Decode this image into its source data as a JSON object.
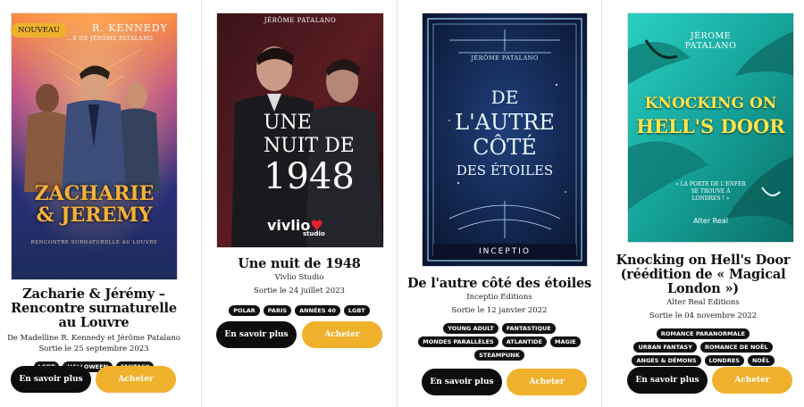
{
  "books": [
    {
      "badge": "NOUVEAU",
      "cover_author": "R. KENNEDY",
      "cover_sub_author": "…S DE JÉRÔME PATALANO",
      "cover_title_line1": "ZACHARIE",
      "cover_title_line2": "& JEREMY",
      "cover_tagline": "RENCONTRE SURNATURELLE AU LOUVRE",
      "title": "Zacharie & Jérémy – Rencontre surnaturelle au Louvre",
      "authors": "De Madelline R. Kennedy et Jérôme Patalano",
      "release": "Sortie le 25 septembre 2023",
      "tags": [
        "LGBT",
        "HALLOWEEN",
        "FANTASY"
      ],
      "more_label": "En savoir plus",
      "buy_label": "Acheter"
    },
    {
      "cover_author": "JÉRÔME PATALANO",
      "cover_title_line1": "UNE",
      "cover_title_line2": "NUIT DE",
      "cover_title_line3": "1948",
      "cover_publisher": "vivlio",
      "cover_publisher_sub": "studio",
      "title": "Une nuit de 1948",
      "publisher": "Vivlio Studio",
      "release": "Sortie le 24 juillet 2023",
      "tags": [
        "POLAR",
        "PARIS",
        "ANNÉES 40",
        "LGBT"
      ],
      "more_label": "En savoir plus",
      "buy_label": "Acheter"
    },
    {
      "cover_author": "JÉRÔME PATALANO",
      "cover_title_line1": "DE",
      "cover_title_line2": "L'AUTRE",
      "cover_title_line3": "CÔTÉ",
      "cover_title_line4": "DES ÉTOILES",
      "cover_publisher": "INCEPTIO",
      "title": "De l'autre côté des étoiles",
      "publisher": "Inceptio Editions",
      "release": "Sortie le 12 janvier 2022",
      "tags": [
        "YOUNG ADULT",
        "FANTASTIQUE",
        "MONDES PARALLÈLES",
        "ATLANTIDE",
        "MAGIE",
        "STEAMPUNK"
      ],
      "more_label": "En savoir plus",
      "buy_label": "Acheter"
    },
    {
      "cover_author_line1": "JÉROME",
      "cover_author_line2": "PATALANO",
      "cover_title_line1": "KNOCKING ON",
      "cover_title_line2": "HELL'S DOOR",
      "cover_quote_line1": "« LA PORTE DE L'ENFER",
      "cover_quote_line2": "SE TROUVE À",
      "cover_quote_line3": "LONDRES ! »",
      "cover_publisher": "Alter Real",
      "title": "Knocking on Hell's Door (réédition de « Magical London »)",
      "publisher": "Alter Real Editions",
      "release": "Sortie le 04 novembre 2022",
      "tags": [
        "ROMANCE PARANORMALE",
        "URBAN FANTASY",
        "ROMANCE DE NOËL",
        "ANGES & DÉMONS",
        "LONDRES",
        "NOËL"
      ],
      "more_label": "En savoir plus",
      "buy_label": "Acheter"
    }
  ],
  "colors": {
    "button_dark": "#0d0d0d",
    "button_gold": "#efb12c",
    "tag_bg": "#111111"
  }
}
